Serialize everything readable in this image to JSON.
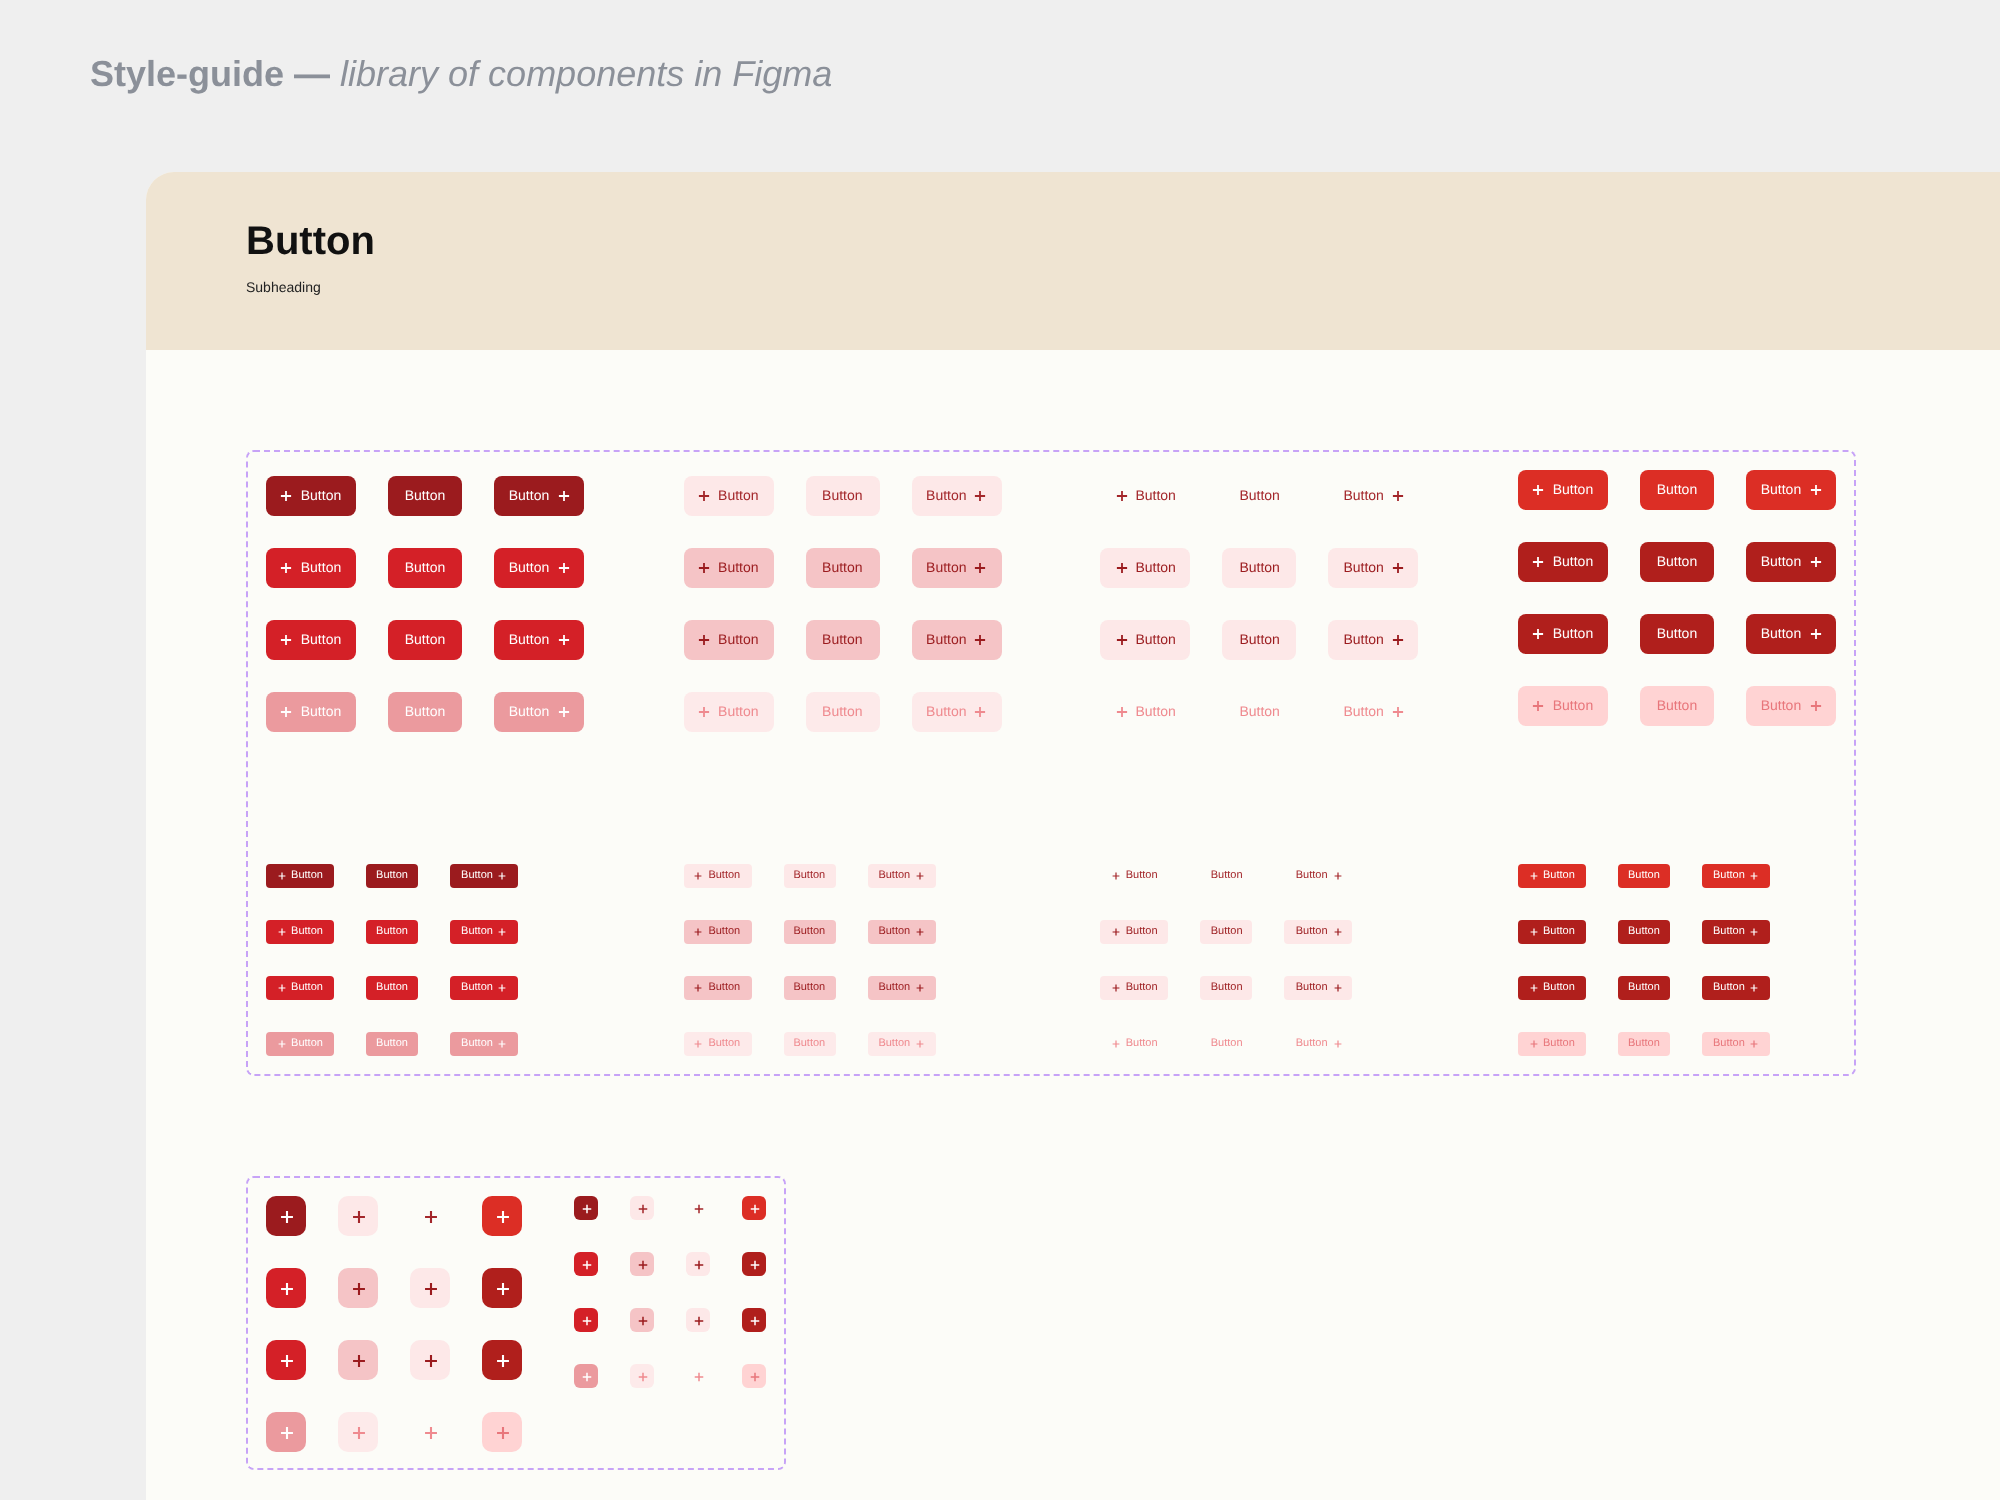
{
  "caption": "**Style-guide —** *library of components in Figma*",
  "card": {
    "title": "Button",
    "subheading": "Subheading"
  },
  "button_sets": [
    {
      "kind": "large",
      "groups": [
        {
          "kind": "primary",
          "rows": [
            {
              "kind": "default",
              "buttons": [
                {
                  "kind": "leading",
                  "label": "Button"
                },
                {
                  "kind": "plain",
                  "label": "Button"
                },
                {
                  "kind": "trailing",
                  "label": "Button"
                }
              ]
            },
            {
              "kind": "hover",
              "buttons": [
                {
                  "kind": "leading",
                  "label": "Button"
                },
                {
                  "kind": "plain",
                  "label": "Button"
                },
                {
                  "kind": "trailing",
                  "label": "Button"
                }
              ]
            },
            {
              "kind": "hover",
              "buttons": [
                {
                  "kind": "leading",
                  "label": "Button"
                },
                {
                  "kind": "plain",
                  "label": "Button"
                },
                {
                  "kind": "trailing",
                  "label": "Button"
                }
              ]
            },
            {
              "kind": "disabled",
              "buttons": [
                {
                  "kind": "leading",
                  "label": "Button"
                },
                {
                  "kind": "plain",
                  "label": "Button"
                },
                {
                  "kind": "trailing",
                  "label": "Button"
                }
              ]
            }
          ]
        },
        {
          "kind": "secondary",
          "rows": [
            {
              "kind": "default",
              "buttons": [
                {
                  "kind": "leading",
                  "label": "Button"
                },
                {
                  "kind": "plain",
                  "label": "Button"
                },
                {
                  "kind": "trailing",
                  "label": "Button"
                }
              ]
            },
            {
              "kind": "hover",
              "buttons": [
                {
                  "kind": "leading",
                  "label": "Button"
                },
                {
                  "kind": "plain",
                  "label": "Button"
                },
                {
                  "kind": "trailing",
                  "label": "Button"
                }
              ]
            },
            {
              "kind": "hover",
              "buttons": [
                {
                  "kind": "leading",
                  "label": "Button"
                },
                {
                  "kind": "plain",
                  "label": "Button"
                },
                {
                  "kind": "trailing",
                  "label": "Button"
                }
              ]
            },
            {
              "kind": "disabled",
              "buttons": [
                {
                  "kind": "leading",
                  "label": "Button"
                },
                {
                  "kind": "plain",
                  "label": "Button"
                },
                {
                  "kind": "trailing",
                  "label": "Button"
                }
              ]
            }
          ]
        },
        {
          "kind": "ghost",
          "rows": [
            {
              "kind": "default",
              "buttons": [
                {
                  "kind": "leading",
                  "label": "Button"
                },
                {
                  "kind": "plain",
                  "label": "Button"
                },
                {
                  "kind": "trailing",
                  "label": "Button"
                }
              ]
            },
            {
              "kind": "hover",
              "buttons": [
                {
                  "kind": "leading",
                  "label": "Button"
                },
                {
                  "kind": "plain",
                  "label": "Button"
                },
                {
                  "kind": "trailing",
                  "label": "Button"
                }
              ]
            },
            {
              "kind": "hover",
              "buttons": [
                {
                  "kind": "leading",
                  "label": "Button"
                },
                {
                  "kind": "plain",
                  "label": "Button"
                },
                {
                  "kind": "trailing",
                  "label": "Button"
                }
              ]
            },
            {
              "kind": "disabled",
              "buttons": [
                {
                  "kind": "leading",
                  "label": "Button"
                },
                {
                  "kind": "plain",
                  "label": "Button"
                },
                {
                  "kind": "trailing",
                  "label": "Button"
                }
              ]
            }
          ]
        },
        {
          "kind": "accent",
          "rows": [
            {
              "kind": "default",
              "buttons": [
                {
                  "kind": "leading",
                  "label": "Button"
                },
                {
                  "kind": "plain",
                  "label": "Button"
                },
                {
                  "kind": "trailing",
                  "label": "Button"
                }
              ]
            },
            {
              "kind": "hover",
              "buttons": [
                {
                  "kind": "leading",
                  "label": "Button"
                },
                {
                  "kind": "plain",
                  "label": "Button"
                },
                {
                  "kind": "trailing",
                  "label": "Button"
                }
              ]
            },
            {
              "kind": "hover",
              "buttons": [
                {
                  "kind": "leading",
                  "label": "Button"
                },
                {
                  "kind": "plain",
                  "label": "Button"
                },
                {
                  "kind": "trailing",
                  "label": "Button"
                }
              ]
            },
            {
              "kind": "disabled",
              "buttons": [
                {
                  "kind": "leading",
                  "label": "Button"
                },
                {
                  "kind": "plain",
                  "label": "Button"
                },
                {
                  "kind": "trailing",
                  "label": "Button"
                }
              ]
            }
          ]
        }
      ]
    },
    {
      "kind": "small",
      "groups": [
        {
          "kind": "primary",
          "rows": [
            {
              "kind": "default",
              "buttons": [
                {
                  "kind": "leading",
                  "label": "Button"
                },
                {
                  "kind": "plain",
                  "label": "Button"
                },
                {
                  "kind": "trailing",
                  "label": "Button"
                }
              ]
            },
            {
              "kind": "hover",
              "buttons": [
                {
                  "kind": "leading",
                  "label": "Button"
                },
                {
                  "kind": "plain",
                  "label": "Button"
                },
                {
                  "kind": "trailing",
                  "label": "Button"
                }
              ]
            },
            {
              "kind": "hover",
              "buttons": [
                {
                  "kind": "leading",
                  "label": "Button"
                },
                {
                  "kind": "plain",
                  "label": "Button"
                },
                {
                  "kind": "trailing",
                  "label": "Button"
                }
              ]
            },
            {
              "kind": "disabled",
              "buttons": [
                {
                  "kind": "leading",
                  "label": "Button"
                },
                {
                  "kind": "plain",
                  "label": "Button"
                },
                {
                  "kind": "trailing",
                  "label": "Button"
                }
              ]
            }
          ]
        },
        {
          "kind": "secondary",
          "rows": [
            {
              "kind": "default",
              "buttons": [
                {
                  "kind": "leading",
                  "label": "Button"
                },
                {
                  "kind": "plain",
                  "label": "Button"
                },
                {
                  "kind": "trailing",
                  "label": "Button"
                }
              ]
            },
            {
              "kind": "hover",
              "buttons": [
                {
                  "kind": "leading",
                  "label": "Button"
                },
                {
                  "kind": "plain",
                  "label": "Button"
                },
                {
                  "kind": "trailing",
                  "label": "Button"
                }
              ]
            },
            {
              "kind": "hover",
              "buttons": [
                {
                  "kind": "leading",
                  "label": "Button"
                },
                {
                  "kind": "plain",
                  "label": "Button"
                },
                {
                  "kind": "trailing",
                  "label": "Button"
                }
              ]
            },
            {
              "kind": "disabled",
              "buttons": [
                {
                  "kind": "leading",
                  "label": "Button"
                },
                {
                  "kind": "plain",
                  "label": "Button"
                },
                {
                  "kind": "trailing",
                  "label": "Button"
                }
              ]
            }
          ]
        },
        {
          "kind": "ghost",
          "rows": [
            {
              "kind": "default",
              "buttons": [
                {
                  "kind": "leading",
                  "label": "Button"
                },
                {
                  "kind": "plain",
                  "label": "Button"
                },
                {
                  "kind": "trailing",
                  "label": "Button"
                }
              ]
            },
            {
              "kind": "hover",
              "buttons": [
                {
                  "kind": "leading",
                  "label": "Button"
                },
                {
                  "kind": "plain",
                  "label": "Button"
                },
                {
                  "kind": "trailing",
                  "label": "Button"
                }
              ]
            },
            {
              "kind": "hover",
              "buttons": [
                {
                  "kind": "leading",
                  "label": "Button"
                },
                {
                  "kind": "plain",
                  "label": "Button"
                },
                {
                  "kind": "trailing",
                  "label": "Button"
                }
              ]
            },
            {
              "kind": "disabled",
              "buttons": [
                {
                  "kind": "leading",
                  "label": "Button"
                },
                {
                  "kind": "plain",
                  "label": "Button"
                },
                {
                  "kind": "trailing",
                  "label": "Button"
                }
              ]
            }
          ]
        },
        {
          "kind": "accent",
          "rows": [
            {
              "kind": "default",
              "buttons": [
                {
                  "kind": "leading",
                  "label": "Button"
                },
                {
                  "kind": "plain",
                  "label": "Button"
                },
                {
                  "kind": "trailing",
                  "label": "Button"
                }
              ]
            },
            {
              "kind": "hover",
              "buttons": [
                {
                  "kind": "leading",
                  "label": "Button"
                },
                {
                  "kind": "plain",
                  "label": "Button"
                },
                {
                  "kind": "trailing",
                  "label": "Button"
                }
              ]
            },
            {
              "kind": "hover",
              "buttons": [
                {
                  "kind": "leading",
                  "label": "Button"
                },
                {
                  "kind": "plain",
                  "label": "Button"
                },
                {
                  "kind": "trailing",
                  "label": "Button"
                }
              ]
            },
            {
              "kind": "disabled",
              "buttons": [
                {
                  "kind": "leading",
                  "label": "Button"
                },
                {
                  "kind": "plain",
                  "label": "Button"
                },
                {
                  "kind": "trailing",
                  "label": "Button"
                }
              ]
            }
          ]
        }
      ]
    }
  ],
  "icon_button_sets": [
    {
      "kind": "large",
      "rows": [
        {
          "kind": "default",
          "buttons": [
            {
              "kind": "primary"
            },
            {
              "kind": "secondary"
            },
            {
              "kind": "ghost"
            },
            {
              "kind": "accent"
            }
          ]
        },
        {
          "kind": "hover",
          "buttons": [
            {
              "kind": "primary"
            },
            {
              "kind": "secondary"
            },
            {
              "kind": "ghost"
            },
            {
              "kind": "accent"
            }
          ]
        },
        {
          "kind": "hover",
          "buttons": [
            {
              "kind": "primary"
            },
            {
              "kind": "secondary"
            },
            {
              "kind": "ghost"
            },
            {
              "kind": "accent"
            }
          ]
        },
        {
          "kind": "disabled",
          "buttons": [
            {
              "kind": "primary"
            },
            {
              "kind": "secondary"
            },
            {
              "kind": "ghost"
            },
            {
              "kind": "accent"
            }
          ]
        }
      ]
    },
    {
      "kind": "small",
      "rows": [
        {
          "kind": "default",
          "buttons": [
            {
              "kind": "primary"
            },
            {
              "kind": "secondary"
            },
            {
              "kind": "ghost"
            },
            {
              "kind": "accent"
            }
          ]
        },
        {
          "kind": "hover",
          "buttons": [
            {
              "kind": "primary"
            },
            {
              "kind": "secondary"
            },
            {
              "kind": "ghost"
            },
            {
              "kind": "accent"
            }
          ]
        },
        {
          "kind": "hover",
          "buttons": [
            {
              "kind": "primary"
            },
            {
              "kind": "secondary"
            },
            {
              "kind": "ghost"
            },
            {
              "kind": "accent"
            }
          ]
        },
        {
          "kind": "disabled",
          "buttons": [
            {
              "kind": "primary"
            },
            {
              "kind": "secondary"
            },
            {
              "kind": "ghost"
            },
            {
              "kind": "accent"
            }
          ]
        }
      ]
    }
  ]
}
